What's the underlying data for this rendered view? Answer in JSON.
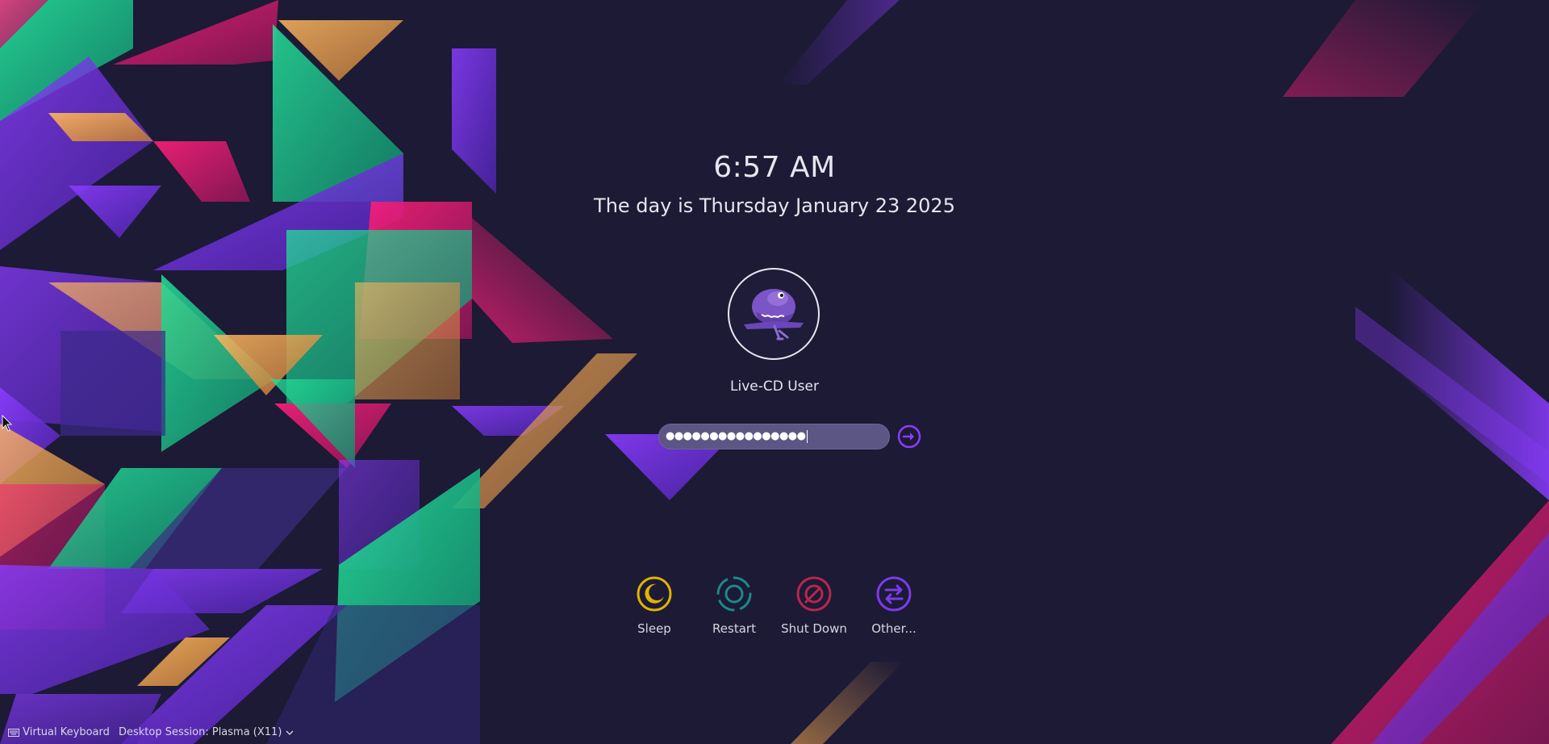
{
  "clock": {
    "time": "6:57 AM",
    "date": "The day is Thursday January 23 2025"
  },
  "user": {
    "name": "Live-CD User",
    "avatar_icon": "purple-dinosaur-mascot"
  },
  "password": {
    "masked_value": "●●●●●●●●●●●●●●●●"
  },
  "login": {
    "icon": "arrow-right-circle-icon"
  },
  "actions": [
    {
      "label": "Sleep",
      "icon": "sleep-moon-icon",
      "color": "#e0b400"
    },
    {
      "label": "Restart",
      "icon": "restart-icon",
      "color": "#1a8a8a"
    },
    {
      "label": "Shut Down",
      "icon": "shutdown-icon",
      "color": "#b8264f"
    },
    {
      "label": "Other...",
      "icon": "switch-user-icon",
      "color": "#7c3aed"
    }
  ],
  "footer": {
    "virtual_keyboard": "Virtual Keyboard",
    "session": "Desktop Session: Plasma (X11)"
  },
  "colors": {
    "background": "#1c1a35",
    "accent_purple": "#7c3aed",
    "accent_green": "#1fd38f",
    "accent_pink": "#e8166a",
    "accent_orange": "#f6a94f"
  }
}
